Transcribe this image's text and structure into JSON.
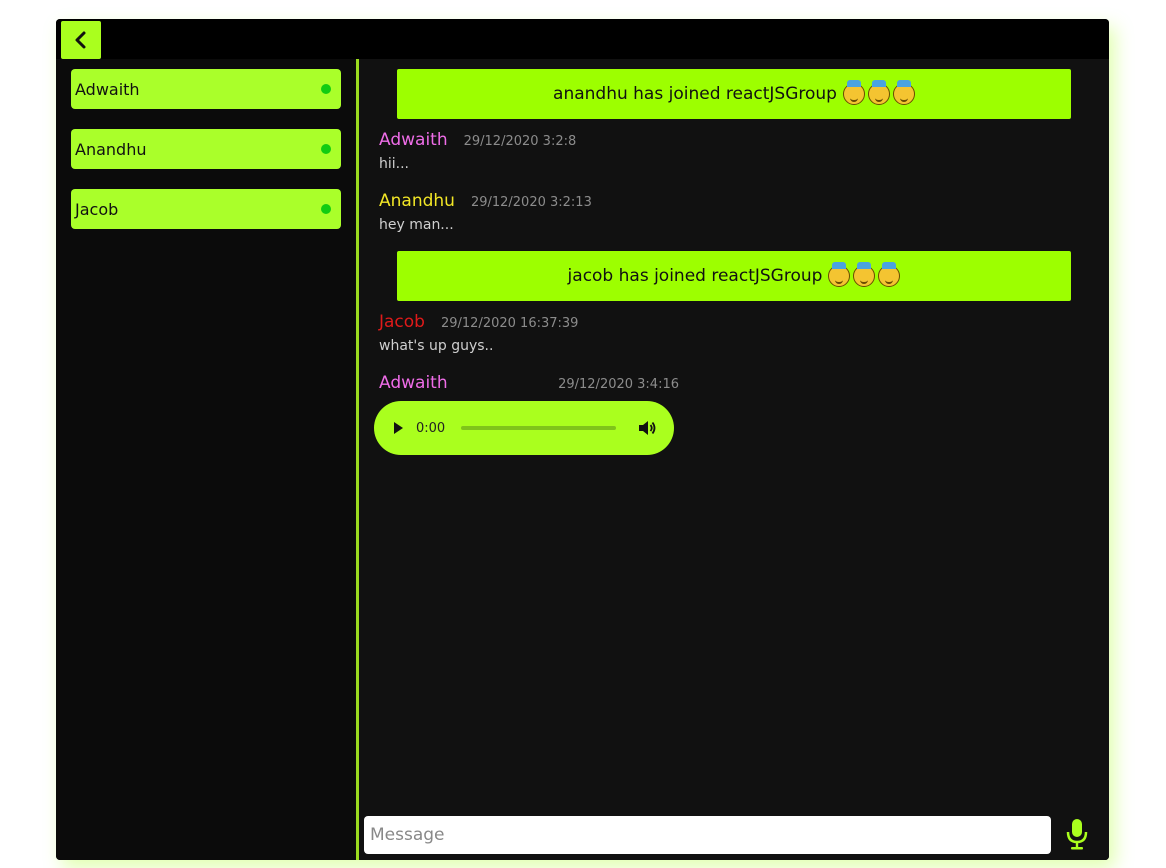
{
  "app": {
    "accent": "#aaff1e"
  },
  "users": [
    {
      "name": "Adwaith",
      "status": "online"
    },
    {
      "name": "Anandhu",
      "status": "online"
    },
    {
      "name": "Jacob",
      "status": "online"
    }
  ],
  "messages": [
    {
      "type": "system",
      "text": "anandhu has joined reactJSGroup"
    },
    {
      "type": "text",
      "sender": "Adwaith",
      "sender_color": "#ef6de8",
      "time": "29/12/2020 3:2:8",
      "text": "hii..."
    },
    {
      "type": "text",
      "sender": "Anandhu",
      "sender_color": "#f2e626",
      "time": "29/12/2020 3:2:13",
      "text": "hey man..."
    },
    {
      "type": "system",
      "text": "jacob has joined reactJSGroup"
    },
    {
      "type": "text",
      "sender": "Jacob",
      "sender_color": "#e01a1a",
      "time": "29/12/2020 16:37:39",
      "text": "what's up guys.."
    },
    {
      "type": "audio",
      "sender": "Adwaith",
      "sender_color": "#ef6de8",
      "time": "29/12/2020 3:4:16",
      "audio_time": "0:00"
    }
  ],
  "composer": {
    "placeholder": "Message"
  },
  "icons": {
    "back": "chevron-left-icon",
    "mic": "mic-icon",
    "play": "play-icon",
    "volume": "volume-icon",
    "emoji": "party-face-emoji"
  }
}
